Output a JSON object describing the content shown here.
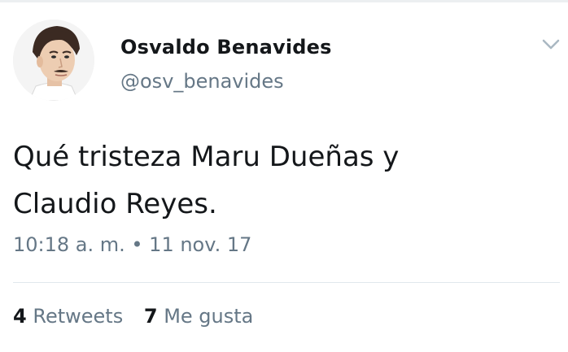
{
  "tweet": {
    "author": {
      "display_name": "Osvaldo Benavides",
      "handle": "@osv_benavides"
    },
    "text_lines": [
      "Qué tristeza Maru Dueñas y",
      "Claudio Reyes."
    ],
    "timestamp": "10:18 a. m. • 11 nov. 17",
    "stats": {
      "retweets_count": "4",
      "retweets_label": "Retweets",
      "likes_count": "7",
      "likes_label": "Me gusta"
    }
  },
  "icons": {
    "menu": "chevron-down-icon",
    "avatar": "profile-photo"
  },
  "colors": {
    "text_primary": "#14171a",
    "text_secondary": "#657786",
    "divider": "#e1e8ed",
    "chevron": "#aab8c2"
  }
}
